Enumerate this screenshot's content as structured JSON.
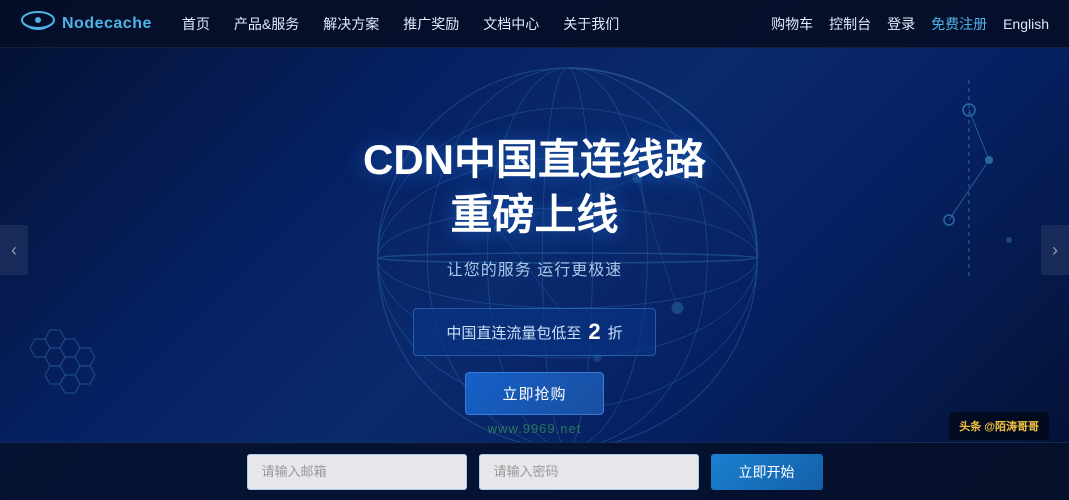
{
  "navbar": {
    "logo_text": "Nodecache",
    "links": [
      {
        "label": "首页",
        "id": "home"
      },
      {
        "label": "产品&服务",
        "id": "products"
      },
      {
        "label": "解决方案",
        "id": "solutions"
      },
      {
        "label": "推广奖励",
        "id": "referral"
      },
      {
        "label": "文档中心",
        "id": "docs"
      },
      {
        "label": "关于我们",
        "id": "about"
      }
    ],
    "right_links": [
      {
        "label": "购物车",
        "id": "cart"
      },
      {
        "label": "控制台",
        "id": "console"
      },
      {
        "label": "登录",
        "id": "login"
      },
      {
        "label": "免费注册",
        "id": "register"
      },
      {
        "label": "English",
        "id": "lang"
      }
    ]
  },
  "hero": {
    "title_line1": "CDN中国直连线路",
    "title_line2": "重磅上线",
    "subtitle": "让您的服务 运行更极速",
    "promo_text_before": "中国直连流量包低至",
    "promo_number": "2",
    "promo_text_after": "折",
    "cta_label": "立即抢购",
    "arrow_left": "‹",
    "arrow_right": "›"
  },
  "bottom_bar": {
    "input1_placeholder": "请输入邮箱",
    "input2_placeholder": "请输入密码",
    "start_label": "立即开始"
  },
  "watermark": {
    "line1": "头条 @陌涛哥哥",
    "url": "www.9969.net"
  }
}
